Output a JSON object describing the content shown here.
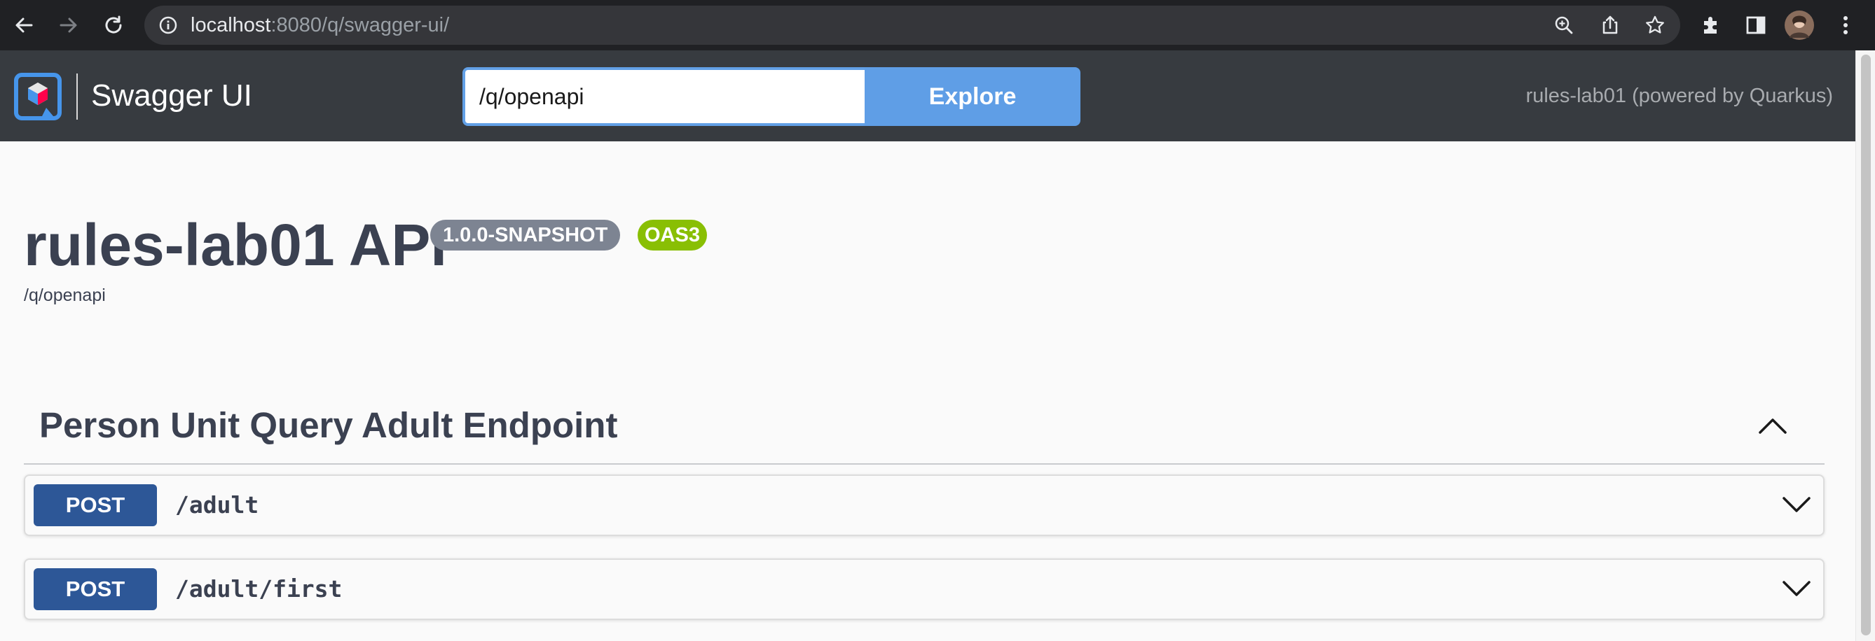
{
  "browser": {
    "url_host": "localhost",
    "url_rest": ":8080/q/swagger-ui/",
    "icons": {
      "back": "arrow-left-icon",
      "forward": "arrow-right-icon",
      "reload": "reload-icon",
      "info": "info-icon",
      "zoom": "zoom-icon",
      "share": "share-icon",
      "bookmark": "star-icon",
      "extensions": "puzzle-icon",
      "side_panel": "side-panel-icon",
      "profile": "avatar",
      "menu": "kebab-menu-icon"
    }
  },
  "topbar": {
    "logo_text": "Swagger UI",
    "url_value": "/q/openapi",
    "explore_label": "Explore",
    "powered_by": "rules-lab01 (powered by Quarkus)",
    "colors": {
      "background": "#373b40",
      "explore": "#5f9ee6"
    }
  },
  "info": {
    "title": "rules-lab01 API",
    "version": "1.0.0-SNAPSHOT",
    "oas_badge": "OAS3",
    "spec_url": "/q/openapi",
    "colors": {
      "version_badge": "#7d8492",
      "oas_badge": "#89bf04"
    }
  },
  "tag": {
    "name": "Person Unit Query Adult Endpoint",
    "expanded": true,
    "operations": [
      {
        "method": "POST",
        "path": "/adult"
      },
      {
        "method": "POST",
        "path": "/adult/first"
      }
    ],
    "colors": {
      "post": "#2d5797"
    }
  }
}
